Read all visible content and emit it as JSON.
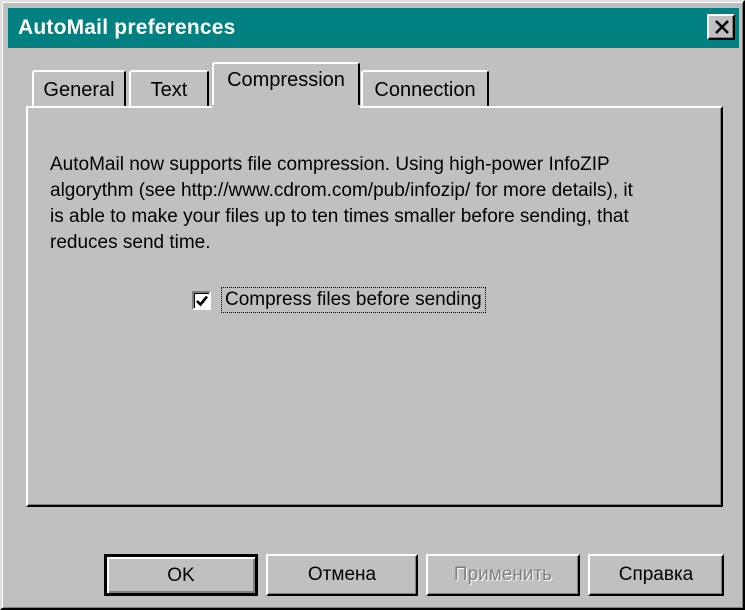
{
  "window": {
    "title": "AutoMail preferences"
  },
  "tabs": [
    {
      "label": "General",
      "active": false
    },
    {
      "label": "Text",
      "active": false
    },
    {
      "label": "Compression",
      "active": true
    },
    {
      "label": "Connection",
      "active": false
    }
  ],
  "compression": {
    "description": "AutoMail now supports file compression. Using high-power InfoZIP algorythm (see http://www.cdrom.com/pub/infozip/ for more details), it is able to make your files up to ten times smaller before sending, that reduces send time.",
    "checkbox_label": "Compress files before sending",
    "checkbox_checked": true
  },
  "buttons": {
    "ok": "OK",
    "cancel": "Отмена",
    "apply": "Применить",
    "help": "Справка"
  },
  "icons": {
    "close": "close-icon",
    "check": "check-icon"
  },
  "colors": {
    "titlebar": "#008080",
    "face": "#c0c0c0"
  }
}
